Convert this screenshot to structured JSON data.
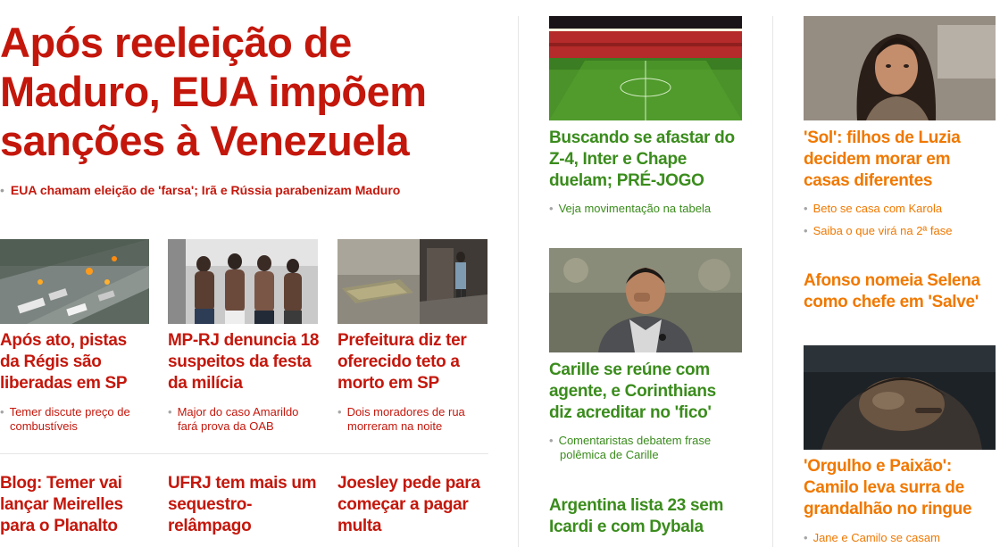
{
  "main": {
    "headline": "Após reeleição de Maduro, EUA impõem sanções à Venezuela",
    "headline_lines": [
      "Após reeleição de",
      "Maduro, EUA impõem",
      "sanções à Venezuela"
    ],
    "sub_link": "EUA chamam eleição de 'farsa'; Irã e Rússia parabenizam Maduro",
    "cards": [
      {
        "title_lines": [
          "Após ato, pistas",
          "da Régis são",
          "liberadas em SP"
        ],
        "related": [
          "Temer discute preço de",
          "combustíveis"
        ]
      },
      {
        "title_lines": [
          "MP-RJ denuncia 18",
          "suspeitos da festa",
          "da milícia"
        ],
        "related": [
          "Major do caso Amarildo",
          "fará prova da OAB"
        ]
      },
      {
        "title_lines": [
          "Prefeitura diz ter",
          "oferecido teto a",
          "morto em SP"
        ],
        "related": [
          "Dois moradores de rua",
          "morreram na noite"
        ]
      }
    ],
    "bottom": [
      {
        "title_lines": [
          "Blog: Temer vai",
          "lançar Meirelles",
          "para o Planalto"
        ]
      },
      {
        "title_lines": [
          "UFRJ tem mais um",
          "sequestro-",
          "relâmpago"
        ]
      },
      {
        "title_lines": [
          "Joesley pede para",
          "começar a pagar",
          "multa"
        ]
      }
    ]
  },
  "sport": {
    "story1": {
      "title_lines": [
        "Buscando se afastar do",
        "Z-4, Inter e Chape",
        "duelam; PRÉ-JOGO"
      ],
      "related": "Veja movimentação na tabela"
    },
    "story2": {
      "title_lines": [
        "Carille se reúne com",
        "agente, e Corinthians",
        "diz acreditar no 'fico'"
      ],
      "related": [
        "Comentaristas debatem frase",
        "polêmica de Carille"
      ]
    },
    "story3": {
      "title_lines": [
        "Argentina lista 23 sem",
        "Icardi e com Dybala"
      ]
    }
  },
  "entertainment": {
    "story1": {
      "title_lines": [
        "'Sol': filhos de Luzia",
        "decidem morar em",
        "casas diferentes"
      ],
      "related": [
        "Beto se casa com Karola",
        "Saiba o que virá na 2ª fase"
      ]
    },
    "story2": {
      "title_lines": [
        "Afonso nomeia Selena",
        "como chefe em 'Salve'"
      ]
    },
    "story3": {
      "title_lines": [
        "'Orgulho e Paixão':",
        "Camilo leva surra de",
        "grandalhão no ringue"
      ],
      "related": "Jane e Camilo se casam"
    }
  },
  "colors": {
    "news_red": "#c4170c",
    "sport_green": "#3a8c1c",
    "entertainment_orange": "#f07800"
  }
}
